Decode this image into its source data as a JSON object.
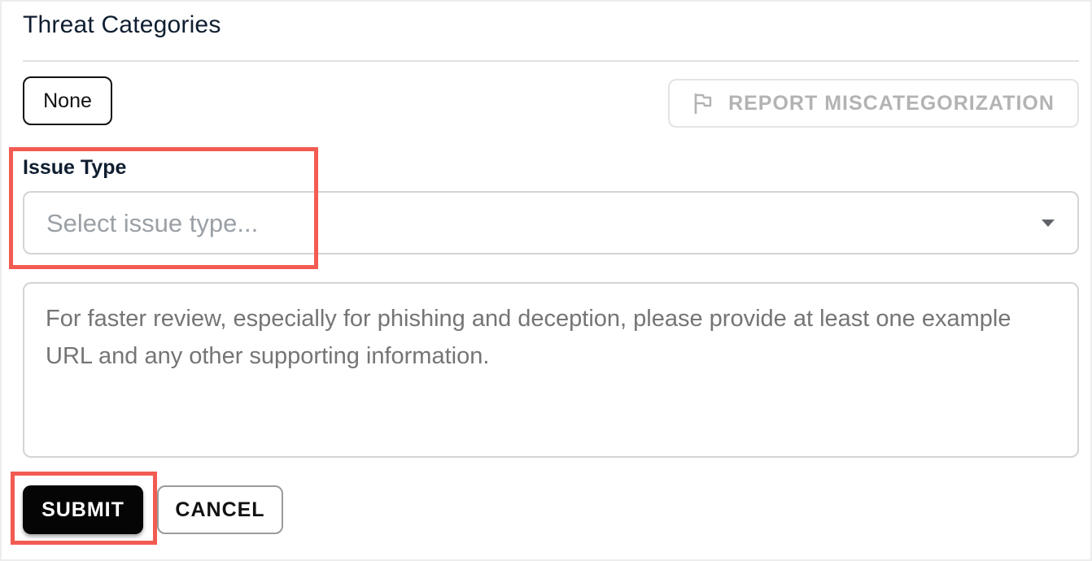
{
  "section": {
    "title": "Threat Categories"
  },
  "category_chip": {
    "label": "None"
  },
  "report_button": {
    "label": "REPORT MISCATEGORIZATION",
    "icon": "flag-icon",
    "state": "disabled"
  },
  "issue_type": {
    "label": "Issue Type",
    "placeholder": "Select issue type...",
    "value": "",
    "icon": "caret-down-icon"
  },
  "details": {
    "placeholder": "For faster review, especially for phishing and deception, please provide at least one example URL and any other supporting information.",
    "value": ""
  },
  "actions": {
    "submit_label": "SUBMIT",
    "cancel_label": "CANCEL"
  },
  "colors": {
    "highlight": "#f25b52",
    "submit_bg": "#050505",
    "title_text": "#0f1e30",
    "disabled_text": "#b3b3b3",
    "placeholder_text": "#9aa0a6"
  }
}
